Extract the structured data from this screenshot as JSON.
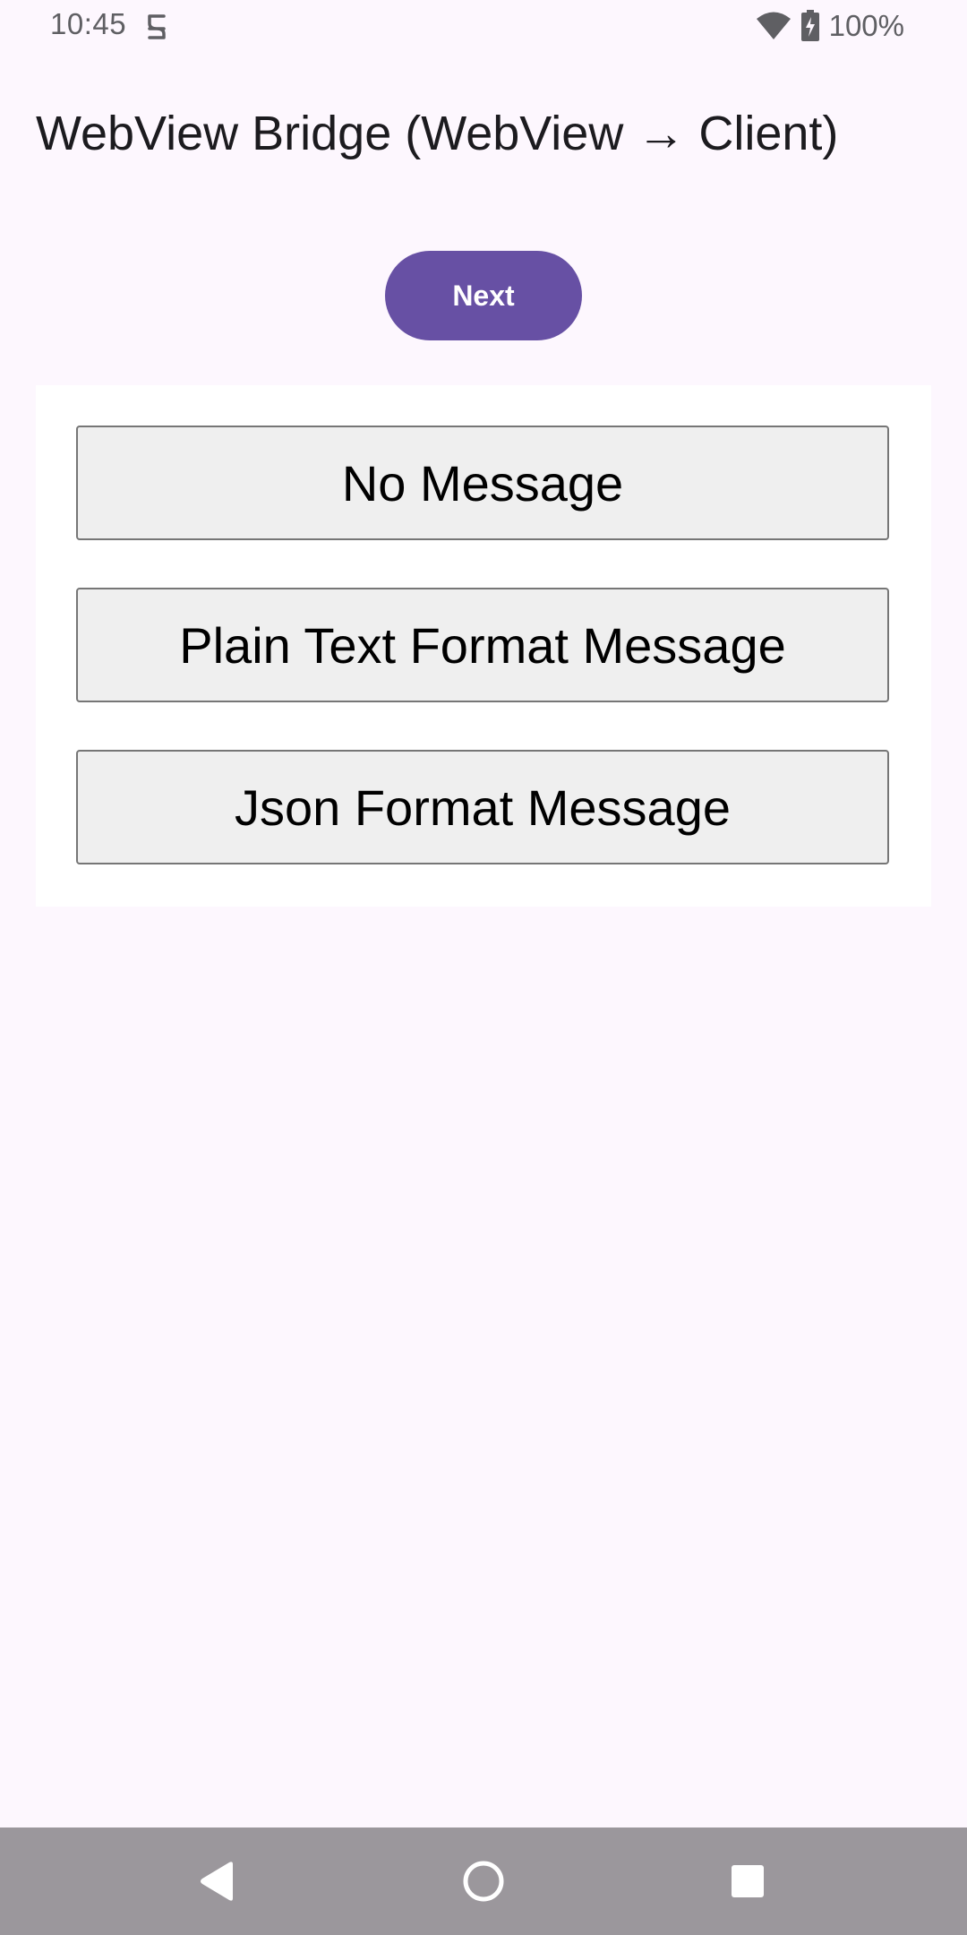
{
  "status_bar": {
    "time": "10:45",
    "battery_percent": "100%",
    "icons": [
      "app-notification-icon",
      "wifi-icon",
      "battery-charging-icon"
    ]
  },
  "header": {
    "title": "WebView Bridge (WebView → Client)"
  },
  "actions": {
    "next_label": "Next"
  },
  "webview": {
    "buttons": [
      {
        "label": "No Message"
      },
      {
        "label": "Plain Text Format Message"
      },
      {
        "label": "Json Format Message"
      }
    ]
  },
  "navigation": {
    "icons": [
      "back-icon",
      "home-icon",
      "recents-icon"
    ]
  },
  "colors": {
    "background": "#fdf7fe",
    "primary": "#6750a4",
    "webview_button_bg": "#efefef",
    "nav_bar": "#9b979c"
  }
}
